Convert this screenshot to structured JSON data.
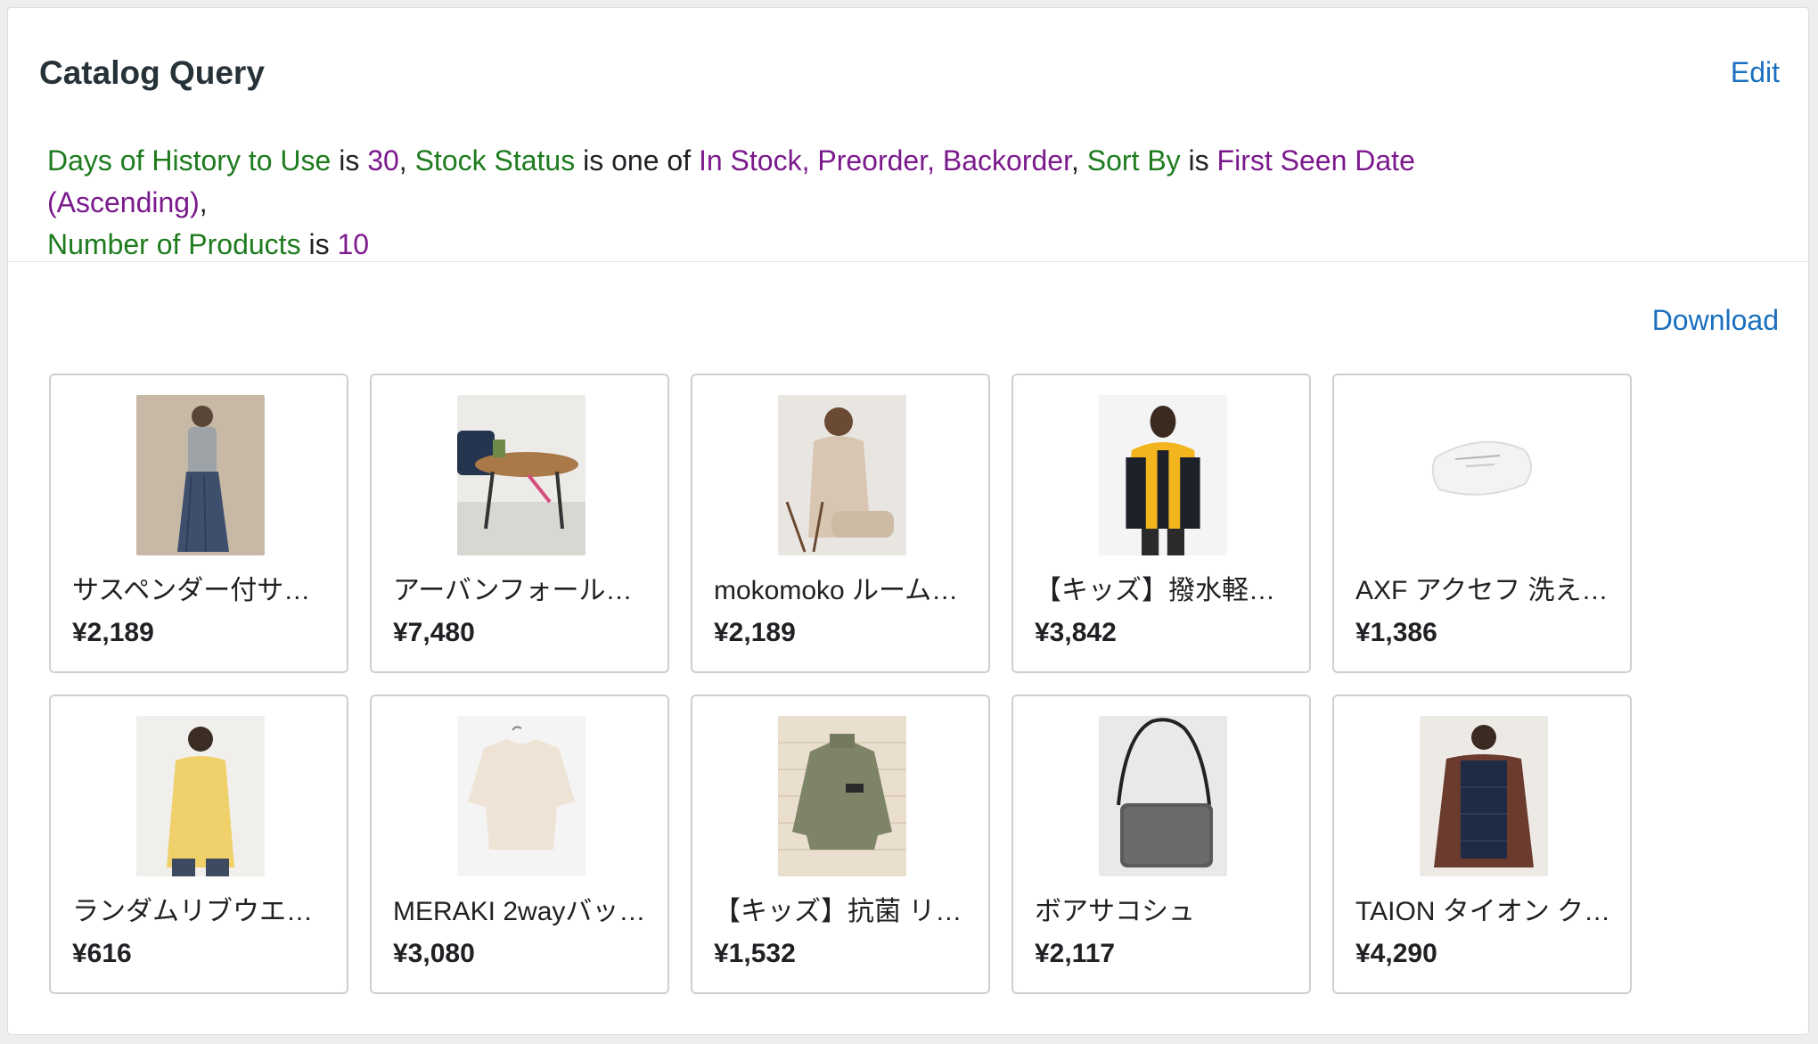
{
  "panel": {
    "title": "Catalog Query",
    "edit_label": "Edit",
    "download_label": "Download"
  },
  "query": {
    "days_label": "Days of History to Use",
    "days_op": "is",
    "days_value": "30",
    "stock_label": "Stock Status",
    "stock_op": "is one of",
    "stock_value": "In Stock, Preorder, Backorder",
    "sort_label": "Sort By",
    "sort_op": "is",
    "sort_value": "First Seen Date (Ascending)",
    "count_label": "Number of Products",
    "count_op": "is",
    "count_value": "10"
  },
  "colors": {
    "field_name": "#1e7b1e",
    "field_value": "#7b1a8c",
    "link": "#1a6fbf"
  },
  "products": [
    {
      "name": "サスペンダー付サ…",
      "price": "¥2,189"
    },
    {
      "name": "アーバンフォール…",
      "price": "¥7,480"
    },
    {
      "name": "mokomoko ルーム…",
      "price": "¥2,189"
    },
    {
      "name": "【キッズ】撥水軽…",
      "price": "¥3,842"
    },
    {
      "name": "AXF アクセフ 洗え…",
      "price": "¥1,386"
    },
    {
      "name": "ランダムリブウエ…",
      "price": "¥616"
    },
    {
      "name": "MERAKI 2wayバッ…",
      "price": "¥3,080"
    },
    {
      "name": "【キッズ】抗菌 リ…",
      "price": "¥1,532"
    },
    {
      "name": "ボアサコシュ",
      "price": "¥2,117"
    },
    {
      "name": "TAION タイオン ク…",
      "price": "¥4,290"
    }
  ]
}
